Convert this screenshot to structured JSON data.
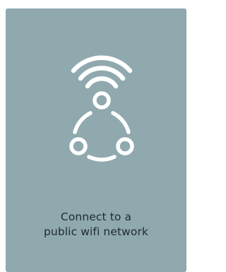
{
  "card": {
    "background_color": "#8fa9af",
    "icon_color": "#ffffff",
    "icon": "wifi-network-share-icon",
    "caption_line1": "Connect to a",
    "caption_line2": "public wifi network"
  }
}
